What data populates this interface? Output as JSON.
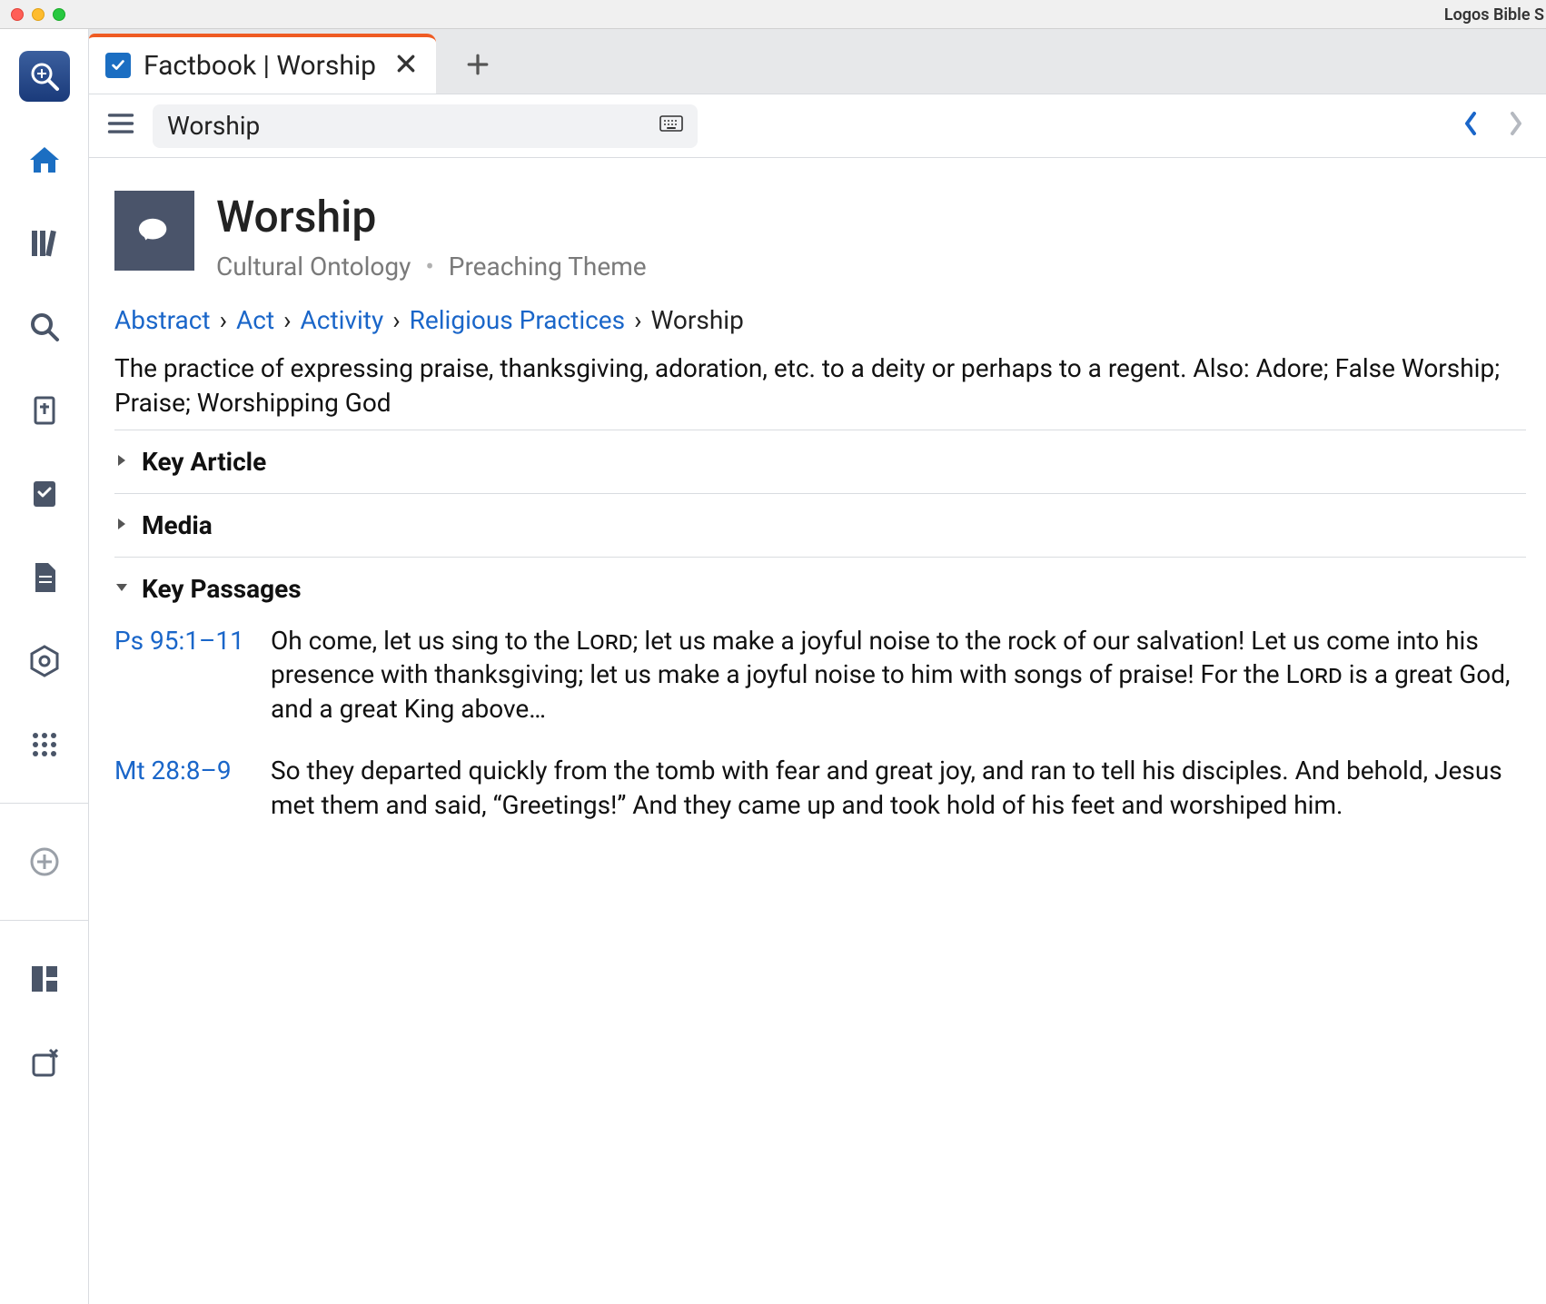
{
  "titlebar": {
    "title": "Logos Bible S"
  },
  "tab": {
    "title": "Factbook | Worship"
  },
  "toolbar": {
    "search_value": "Worship"
  },
  "hero": {
    "title": "Worship",
    "category1": "Cultural Ontology",
    "category2": "Preaching Theme"
  },
  "breadcrumb": {
    "items": [
      {
        "label": "Abstract",
        "link": true
      },
      {
        "label": "Act",
        "link": true
      },
      {
        "label": "Activity",
        "link": true
      },
      {
        "label": "Religious Practices",
        "link": true
      },
      {
        "label": "Worship",
        "link": false
      }
    ]
  },
  "description": "The practice of expressing praise, thanksgiving, adoration, etc. to a deity or perhaps to a regent. Also: Adore; False Worship; Praise; Worshipping God",
  "sections": {
    "key_article": {
      "title": "Key Article",
      "expanded": false
    },
    "media": {
      "title": "Media",
      "expanded": false
    },
    "key_passages": {
      "title": "Key Passages",
      "expanded": true
    }
  },
  "passages": [
    {
      "ref": "Ps 95:1–11",
      "text_before": "Oh come, let us sing to the ",
      "sc1": "Lord",
      "text_mid": "; let us make a joyful noise to the rock of our salvation! Let us come into his presence with thanksgiving; let us make a joyful noise to him with songs of praise! For the ",
      "sc2": "Lord",
      "text_after": " is a great God, and a great King above…"
    },
    {
      "ref": "Mt 28:8–9",
      "text": "So they departed quickly from the tomb with fear and great joy, and ran to tell his disciples. And behold, Jesus met them and said, “Greetings!” And they came up and took hold of his feet and worshiped him."
    }
  ]
}
